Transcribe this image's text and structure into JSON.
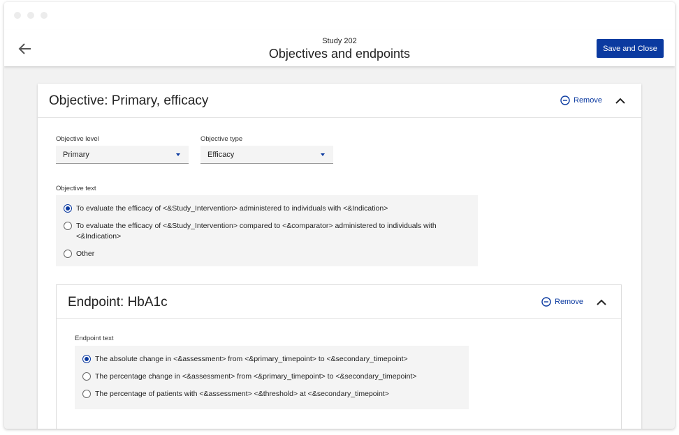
{
  "header": {
    "study_name": "Study 202",
    "page_title": "Objectives and endpoints",
    "save_label": "Save and Close"
  },
  "objective": {
    "title": "Objective: Primary, efficacy",
    "remove_label": "Remove",
    "level_label": "Objective level",
    "level_value": "Primary",
    "type_label": "Objective type",
    "type_value": "Efficacy",
    "text_label": "Objective text",
    "options": [
      {
        "text": "To evaluate the efficacy of <&Study_Intervention> administered to individuals with <&Indication>",
        "selected": true
      },
      {
        "text": "To evaluate the efficacy of <&Study_Intervention> compared to <&comparator> administered to individuals with <&Indication>",
        "selected": false
      },
      {
        "text": "Other",
        "selected": false
      }
    ]
  },
  "endpoint": {
    "title": "Endpoint: HbA1c",
    "remove_label": "Remove",
    "text_label": "Endpoint text",
    "options": [
      {
        "text": "The absolute change in <&assessment> from <&primary_timepoint> to <&secondary_timepoint>",
        "selected": true
      },
      {
        "text": "The percentage change in <&assessment> from <&primary_timepoint> to <&secondary_timepoint>",
        "selected": false
      },
      {
        "text": "The percentage of patients with <&assessment>  <&threshold> at <&secondary_timepoint>",
        "selected": false
      }
    ]
  },
  "colors": {
    "accent": "#0b3aa0",
    "background": "#f2f2f2"
  }
}
